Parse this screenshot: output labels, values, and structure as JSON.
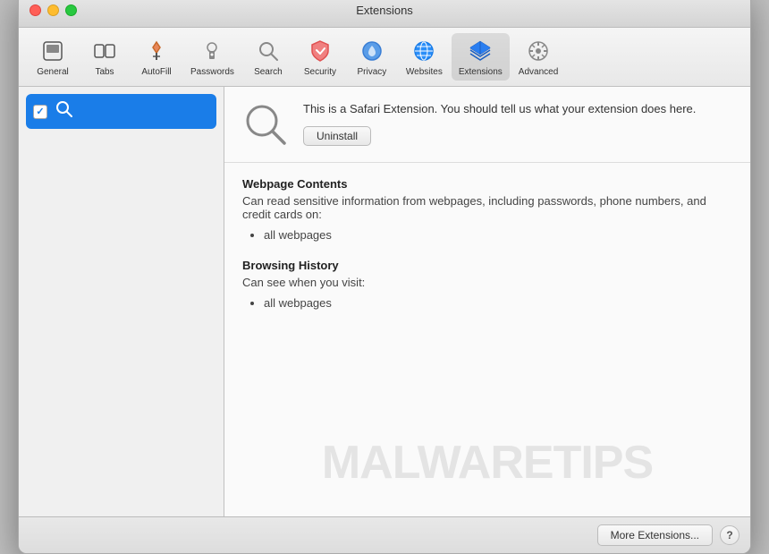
{
  "window": {
    "title": "Extensions"
  },
  "toolbar": {
    "items": [
      {
        "id": "general",
        "label": "General",
        "icon": "general"
      },
      {
        "id": "tabs",
        "label": "Tabs",
        "icon": "tabs"
      },
      {
        "id": "autofill",
        "label": "AutoFill",
        "icon": "autofill"
      },
      {
        "id": "passwords",
        "label": "Passwords",
        "icon": "passwords"
      },
      {
        "id": "search",
        "label": "Search",
        "icon": "search"
      },
      {
        "id": "security",
        "label": "Security",
        "icon": "security"
      },
      {
        "id": "privacy",
        "label": "Privacy",
        "icon": "privacy"
      },
      {
        "id": "websites",
        "label": "Websites",
        "icon": "websites"
      },
      {
        "id": "extensions",
        "label": "Extensions",
        "icon": "extensions",
        "active": true
      },
      {
        "id": "advanced",
        "label": "Advanced",
        "icon": "advanced"
      }
    ]
  },
  "sidebar": {
    "items": [
      {
        "id": "search-ext",
        "label": "Search",
        "checked": true
      }
    ]
  },
  "extension": {
    "description": "This is a Safari Extension. You should tell us what your extension does here.",
    "uninstall_label": "Uninstall",
    "permissions": [
      {
        "title": "Webpage Contents",
        "description": "Can read sensitive information from webpages, including passwords, phone numbers, and credit cards on:",
        "items": [
          "all webpages"
        ]
      },
      {
        "title": "Browsing History",
        "description": "Can see when you visit:",
        "items": [
          "all webpages"
        ]
      }
    ]
  },
  "footer": {
    "more_extensions_label": "More Extensions...",
    "help_label": "?"
  },
  "watermark": {
    "text": "MALWARETIPS"
  }
}
